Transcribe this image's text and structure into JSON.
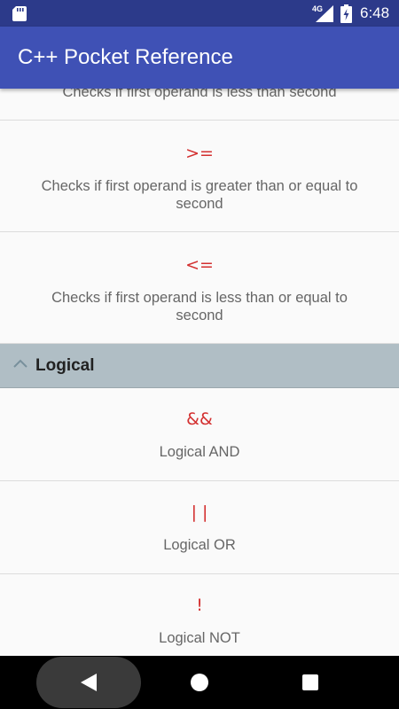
{
  "status_bar": {
    "network": "4G",
    "time": "6:48",
    "icons": [
      "sd-card-icon",
      "signal-icon",
      "battery-icon"
    ]
  },
  "app_bar": {
    "title": "C++ Pocket Reference"
  },
  "operators": [
    {
      "symbol": "<",
      "description": "Checks if first operand is less than second"
    },
    {
      "symbol": ">=",
      "description": "Checks if first operand is greater than or equal to second"
    },
    {
      "symbol": "<=",
      "description": "Checks if first operand is less than or equal to second"
    }
  ],
  "section": {
    "label": "Logical",
    "icon": "chevron-up-icon",
    "items": [
      {
        "symbol": "&&",
        "description": "Logical AND"
      },
      {
        "symbol": "| |",
        "description": "Logical OR"
      },
      {
        "symbol": "!",
        "description": "Logical NOT"
      }
    ]
  },
  "nav_bar": {
    "icons": [
      "back-icon",
      "home-icon",
      "recents-icon"
    ]
  },
  "colors": {
    "status_bar": "#2c3a8a",
    "app_bar": "#3f51b5",
    "operator_symbol": "#d32f2f",
    "section_header": "#b0bec5"
  }
}
